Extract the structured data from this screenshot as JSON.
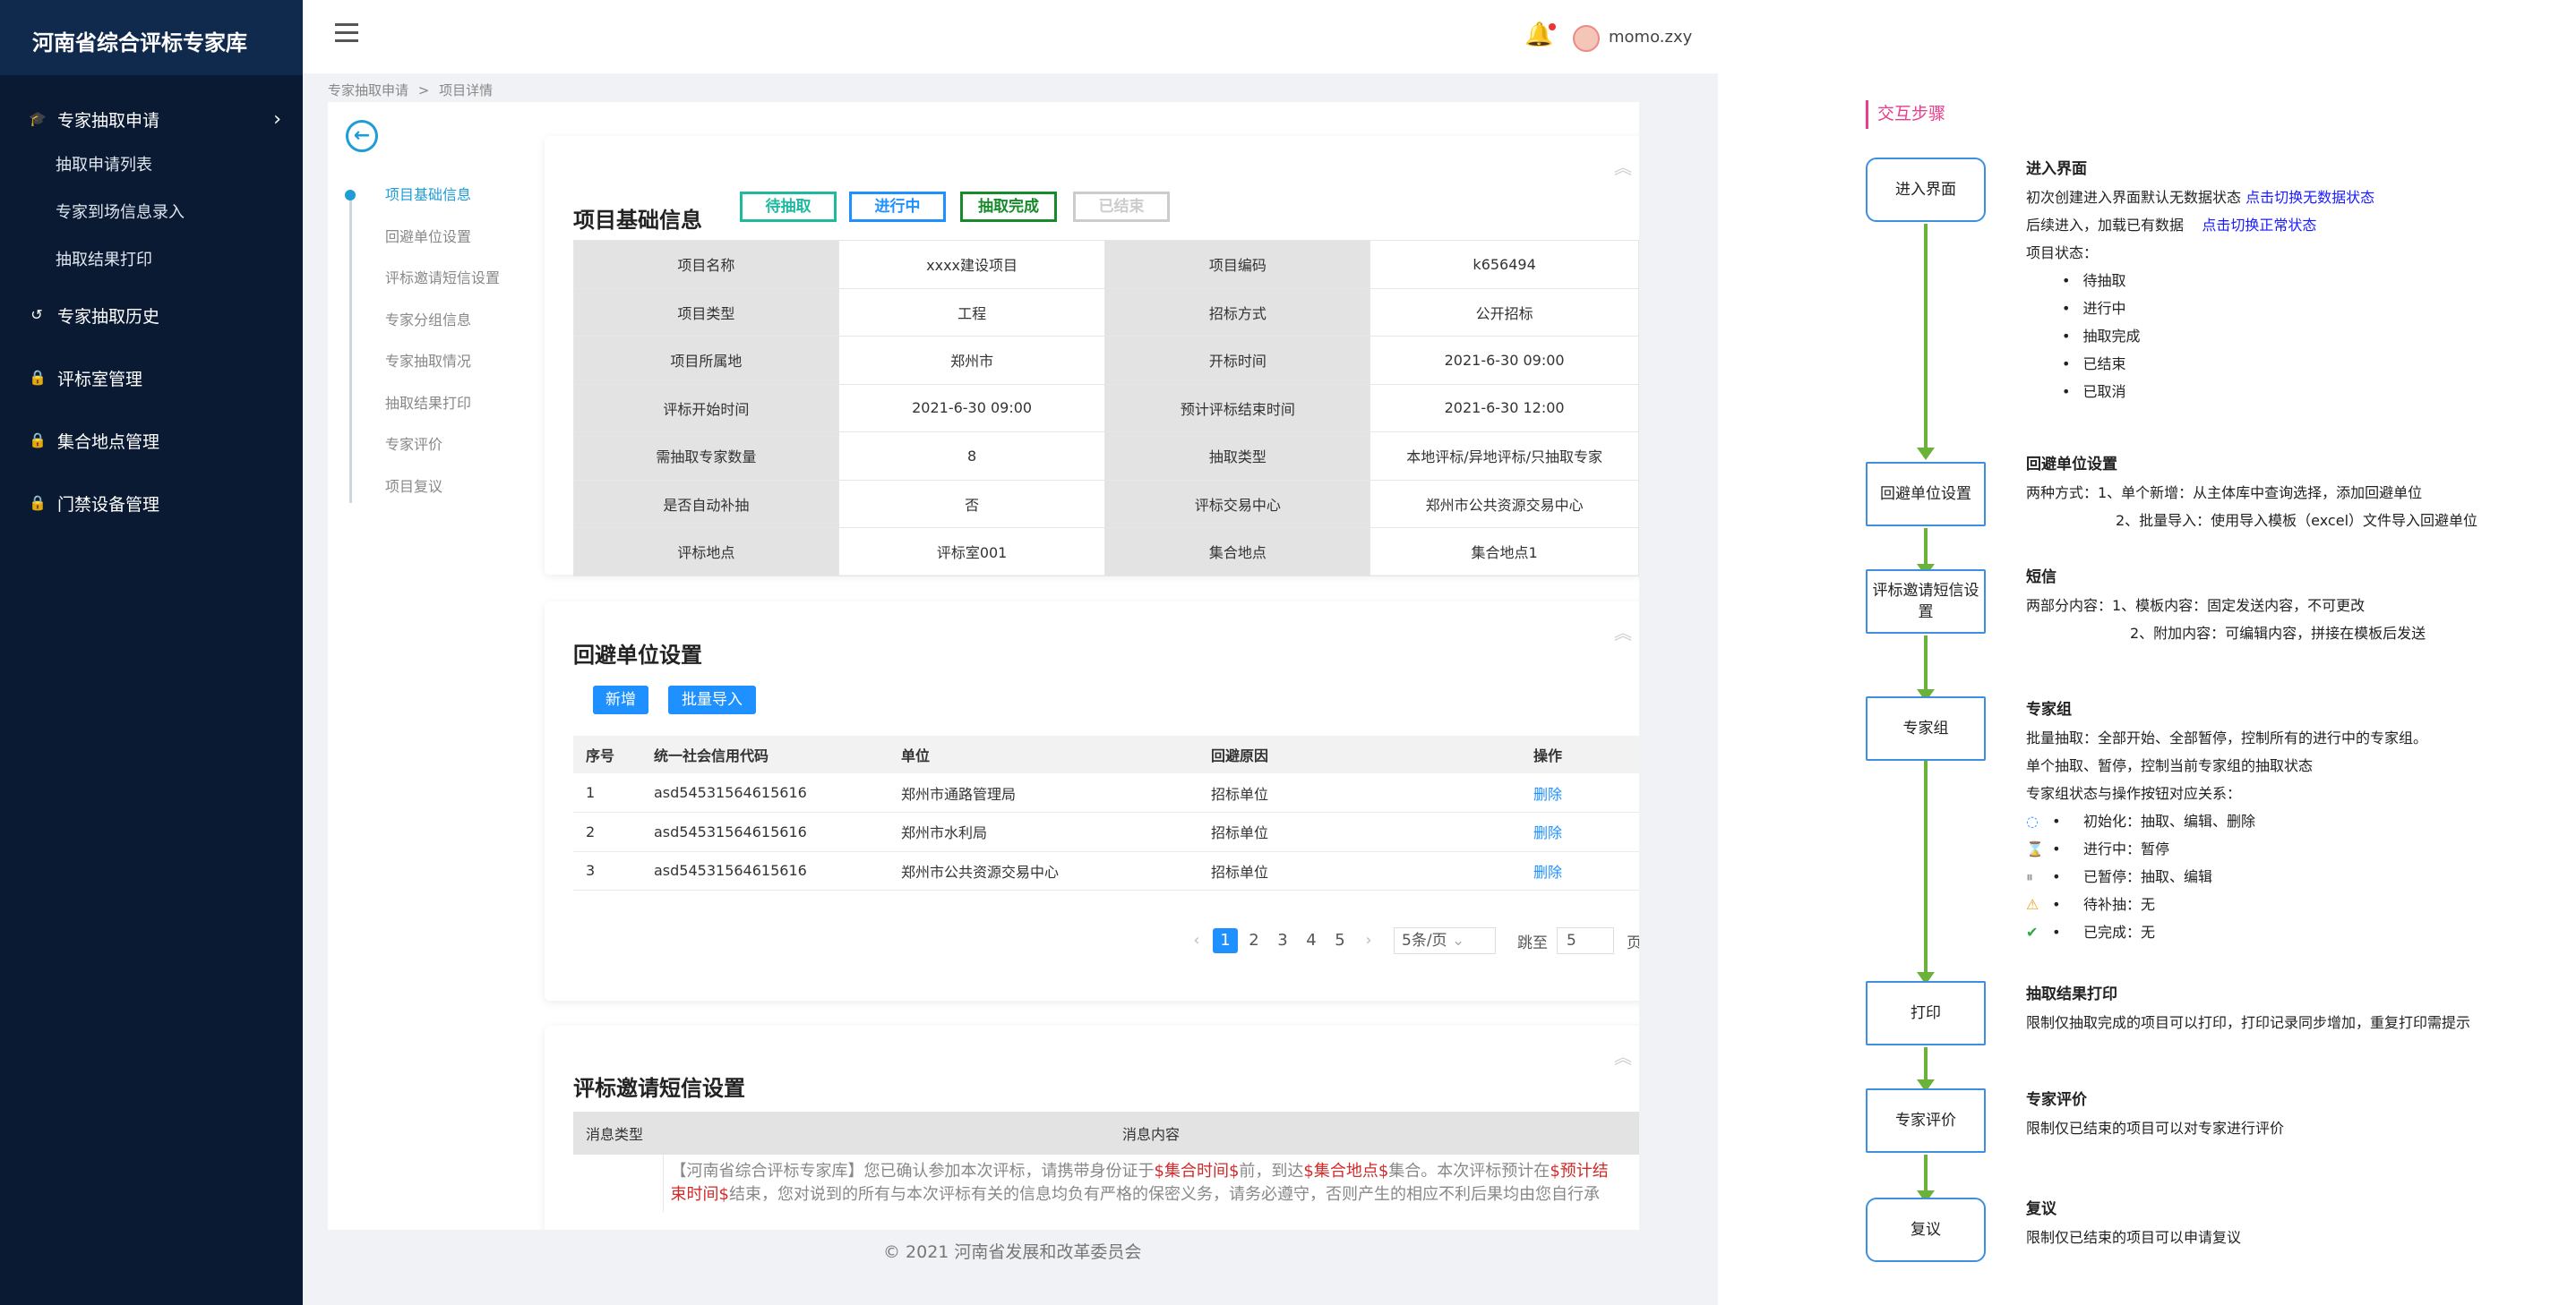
{
  "sidebar": {
    "title": "河南省综合评标专家库",
    "groups": [
      {
        "label": "专家抽取申请",
        "items": [
          "抽取申请列表",
          "专家到场信息录入",
          "抽取结果打印"
        ]
      },
      {
        "label": "专家抽取历史"
      },
      {
        "label": "评标室管理"
      },
      {
        "label": "集合地点管理"
      },
      {
        "label": "门禁设备管理"
      }
    ]
  },
  "header": {
    "username": "momo.zxy"
  },
  "breadcrumb": {
    "parent": "专家抽取申请",
    "sep": ">",
    "current": "项目详情"
  },
  "steps": [
    "项目基础信息",
    "回避单位设置",
    "评标邀请短信设置",
    "专家分组信息",
    "专家抽取情况",
    "抽取结果打印",
    "专家评价",
    "项目复议"
  ],
  "basic": {
    "title": "项目基础信息",
    "tags": [
      "待抽取",
      "进行中",
      "抽取完成",
      "已结束"
    ],
    "rows": [
      [
        "项目名称",
        "xxxx建设项目",
        "项目编码",
        "k656494"
      ],
      [
        "项目类型",
        "工程",
        "招标方式",
        "公开招标"
      ],
      [
        "项目所属地",
        "郑州市",
        "开标时间",
        "2021-6-30 09:00"
      ],
      [
        "评标开始时间",
        "2021-6-30 09:00",
        "预计评标结束时间",
        "2021-6-30 12:00"
      ],
      [
        "需抽取专家数量",
        "8",
        "抽取类型",
        "本地评标/异地评标/只抽取专家"
      ],
      [
        "是否自动补抽",
        "否",
        "评标交易中心",
        "郑州市公共资源交易中心"
      ],
      [
        "评标地点",
        "评标室001",
        "集合地点",
        "集合地点1"
      ]
    ]
  },
  "avoid": {
    "title": "回避单位设置",
    "add_label": "新增",
    "import_label": "批量导入",
    "columns": [
      "序号",
      "统一社会信用代码",
      "单位",
      "回避原因",
      "操作"
    ],
    "rows": [
      [
        "1",
        "asd54531564615616",
        "郑州市通路管理局",
        "招标单位",
        "删除"
      ],
      [
        "2",
        "asd54531564615616",
        "郑州市水利局",
        "招标单位",
        "删除"
      ],
      [
        "3",
        "asd54531564615616",
        "郑州市公共资源交易中心",
        "招标单位",
        "删除"
      ]
    ],
    "pager": {
      "pages": [
        "1",
        "2",
        "3",
        "4",
        "5"
      ],
      "page_size": "5条/页",
      "goto_label": "跳至",
      "goto_value": "5",
      "page_unit": "页"
    }
  },
  "sms": {
    "title": "评标邀请短信设置",
    "columns": [
      "消息类型",
      "消息内容"
    ],
    "line1": {
      "a": "【河南省综合评标专家库】您已确认参加本次评标，请携带身份证于",
      "v1": "$集合时间$",
      "b": "前，到达",
      "v2": "$集合地点$",
      "c": "集合。本次评标预计在",
      "v3": "$预计结"
    },
    "line2": {
      "v": "束时间$",
      "a": "结束，您对说到的所有与本次评标有关的信息均负有严格的保密义务，请务必遵守，否则产生的相应不利后果均由您自行承"
    }
  },
  "footer": "© 2021 河南省发展和改革委员会",
  "flow": {
    "heading": "交互步骤",
    "nodes": [
      "进入界面",
      "回避单位设置",
      "评标邀请短信设置",
      "专家组",
      "打印",
      "专家评价",
      "复议"
    ],
    "enter": {
      "title": "进入界面",
      "l1": "初次创建进入界面默认无数据状态",
      "l1_link": "点击切换无数据状态",
      "l2": "后续进入，加载已有数据",
      "l2_link": "点击切换正常状态",
      "l3": "项目状态：",
      "states": [
        "待抽取",
        "进行中",
        "抽取完成",
        "已结束",
        "已取消"
      ]
    },
    "avoid": {
      "title": "回避单位设置",
      "l1": "两种方式：1、单个新增：从主体库中查询选择，添加回避单位",
      "l2": "2、批量导入：使用导入模板（excel）文件导入回避单位"
    },
    "sms": {
      "title": "短信",
      "l1": "两部分内容：1、模板内容：固定发送内容，不可更改",
      "l2": "2、附加内容：可编辑内容，拼接在模板后发送"
    },
    "group": {
      "title": "专家组",
      "l1": "批量抽取：全部开始、全部暂停，控制所有的进行中的专家组。",
      "l2": "单个抽取、暂停，控制当前专家组的抽取状态",
      "l3": "专家组状态与操作按钮对应关系：",
      "states": [
        "初始化：抽取、编辑、删除",
        "进行中：暂停",
        "已暂停：抽取、编辑",
        "待补抽：无",
        "已完成：无"
      ]
    },
    "print": {
      "title": "抽取结果打印",
      "l1": "限制仅抽取完成的项目可以打印，打印记录同步增加，重复打印需提示"
    },
    "rate": {
      "title": "专家评价",
      "l1": "限制仅已结束的项目可以对专家进行评价"
    },
    "review": {
      "title": "复议",
      "l1": "限制仅已结束的项目可以申请复议"
    }
  },
  "colors": {
    "sidebar": "#0b1a33",
    "accent": "#1e90ff",
    "flow_line": "#6ab23a",
    "tag_pending": "#1fb9a0",
    "tag_running": "#1e90ff",
    "tag_done": "#178a2a",
    "tag_ended": "#cccccc"
  }
}
